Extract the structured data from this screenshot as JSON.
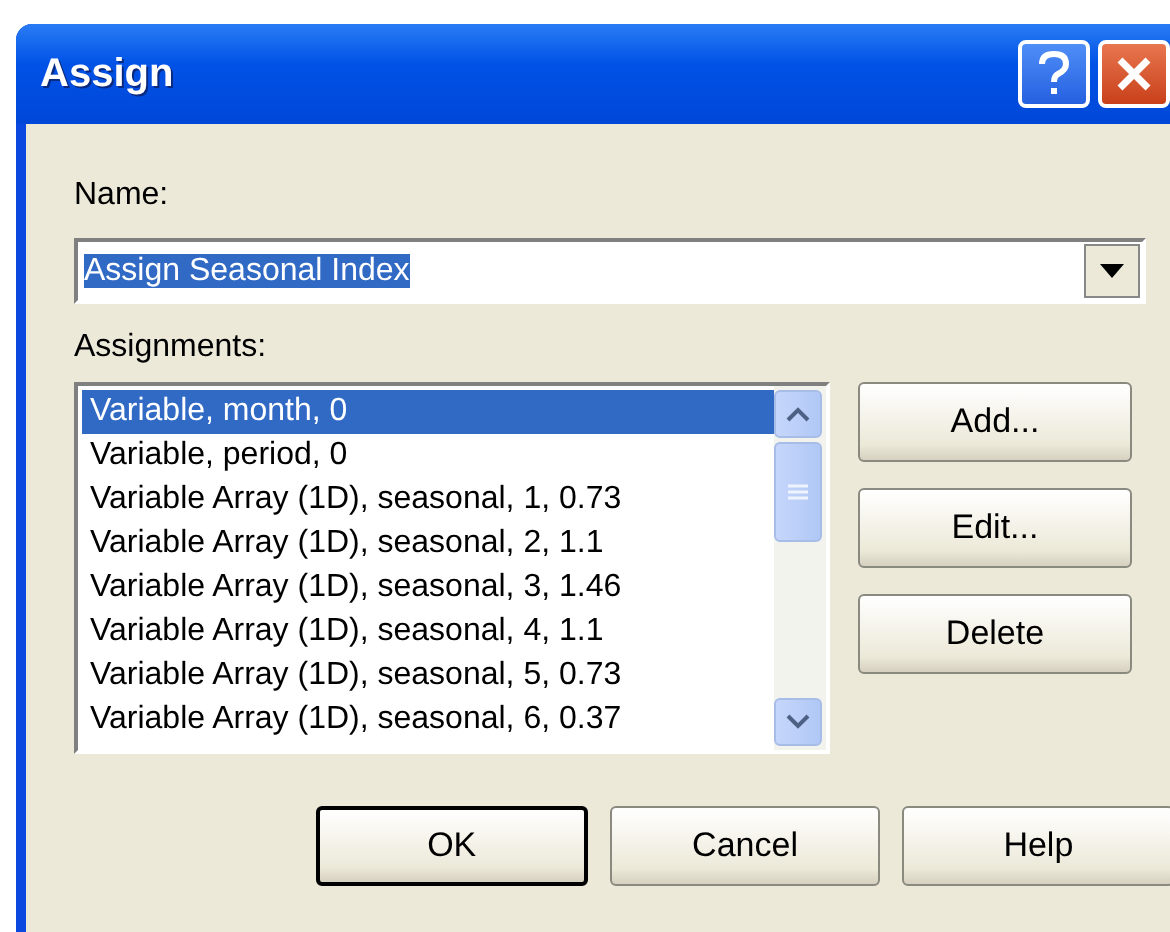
{
  "window": {
    "title": "Assign"
  },
  "name_field": {
    "label": "Name:",
    "value": "Assign Seasonal Index",
    "value_selected": true
  },
  "assignments": {
    "label": "Assignments:",
    "items": [
      {
        "text": "Variable, month, 0",
        "selected": true
      },
      {
        "text": "Variable, period, 0",
        "selected": false
      },
      {
        "text": "Variable Array (1D), seasonal, 1, 0.73",
        "selected": false
      },
      {
        "text": "Variable Array (1D), seasonal, 2, 1.1",
        "selected": false
      },
      {
        "text": "Variable Array (1D), seasonal, 3, 1.46",
        "selected": false
      },
      {
        "text": "Variable Array (1D), seasonal, 4, 1.1",
        "selected": false
      },
      {
        "text": "Variable Array (1D), seasonal, 5, 0.73",
        "selected": false
      },
      {
        "text": "Variable Array (1D), seasonal, 6, 0.37",
        "selected": false
      }
    ]
  },
  "side_buttons": [
    "Add...",
    "Edit...",
    "Delete"
  ],
  "buttons": [
    {
      "label": "OK",
      "default": true
    },
    {
      "label": "Cancel",
      "default": false
    },
    {
      "label": "Help",
      "default": false
    }
  ]
}
